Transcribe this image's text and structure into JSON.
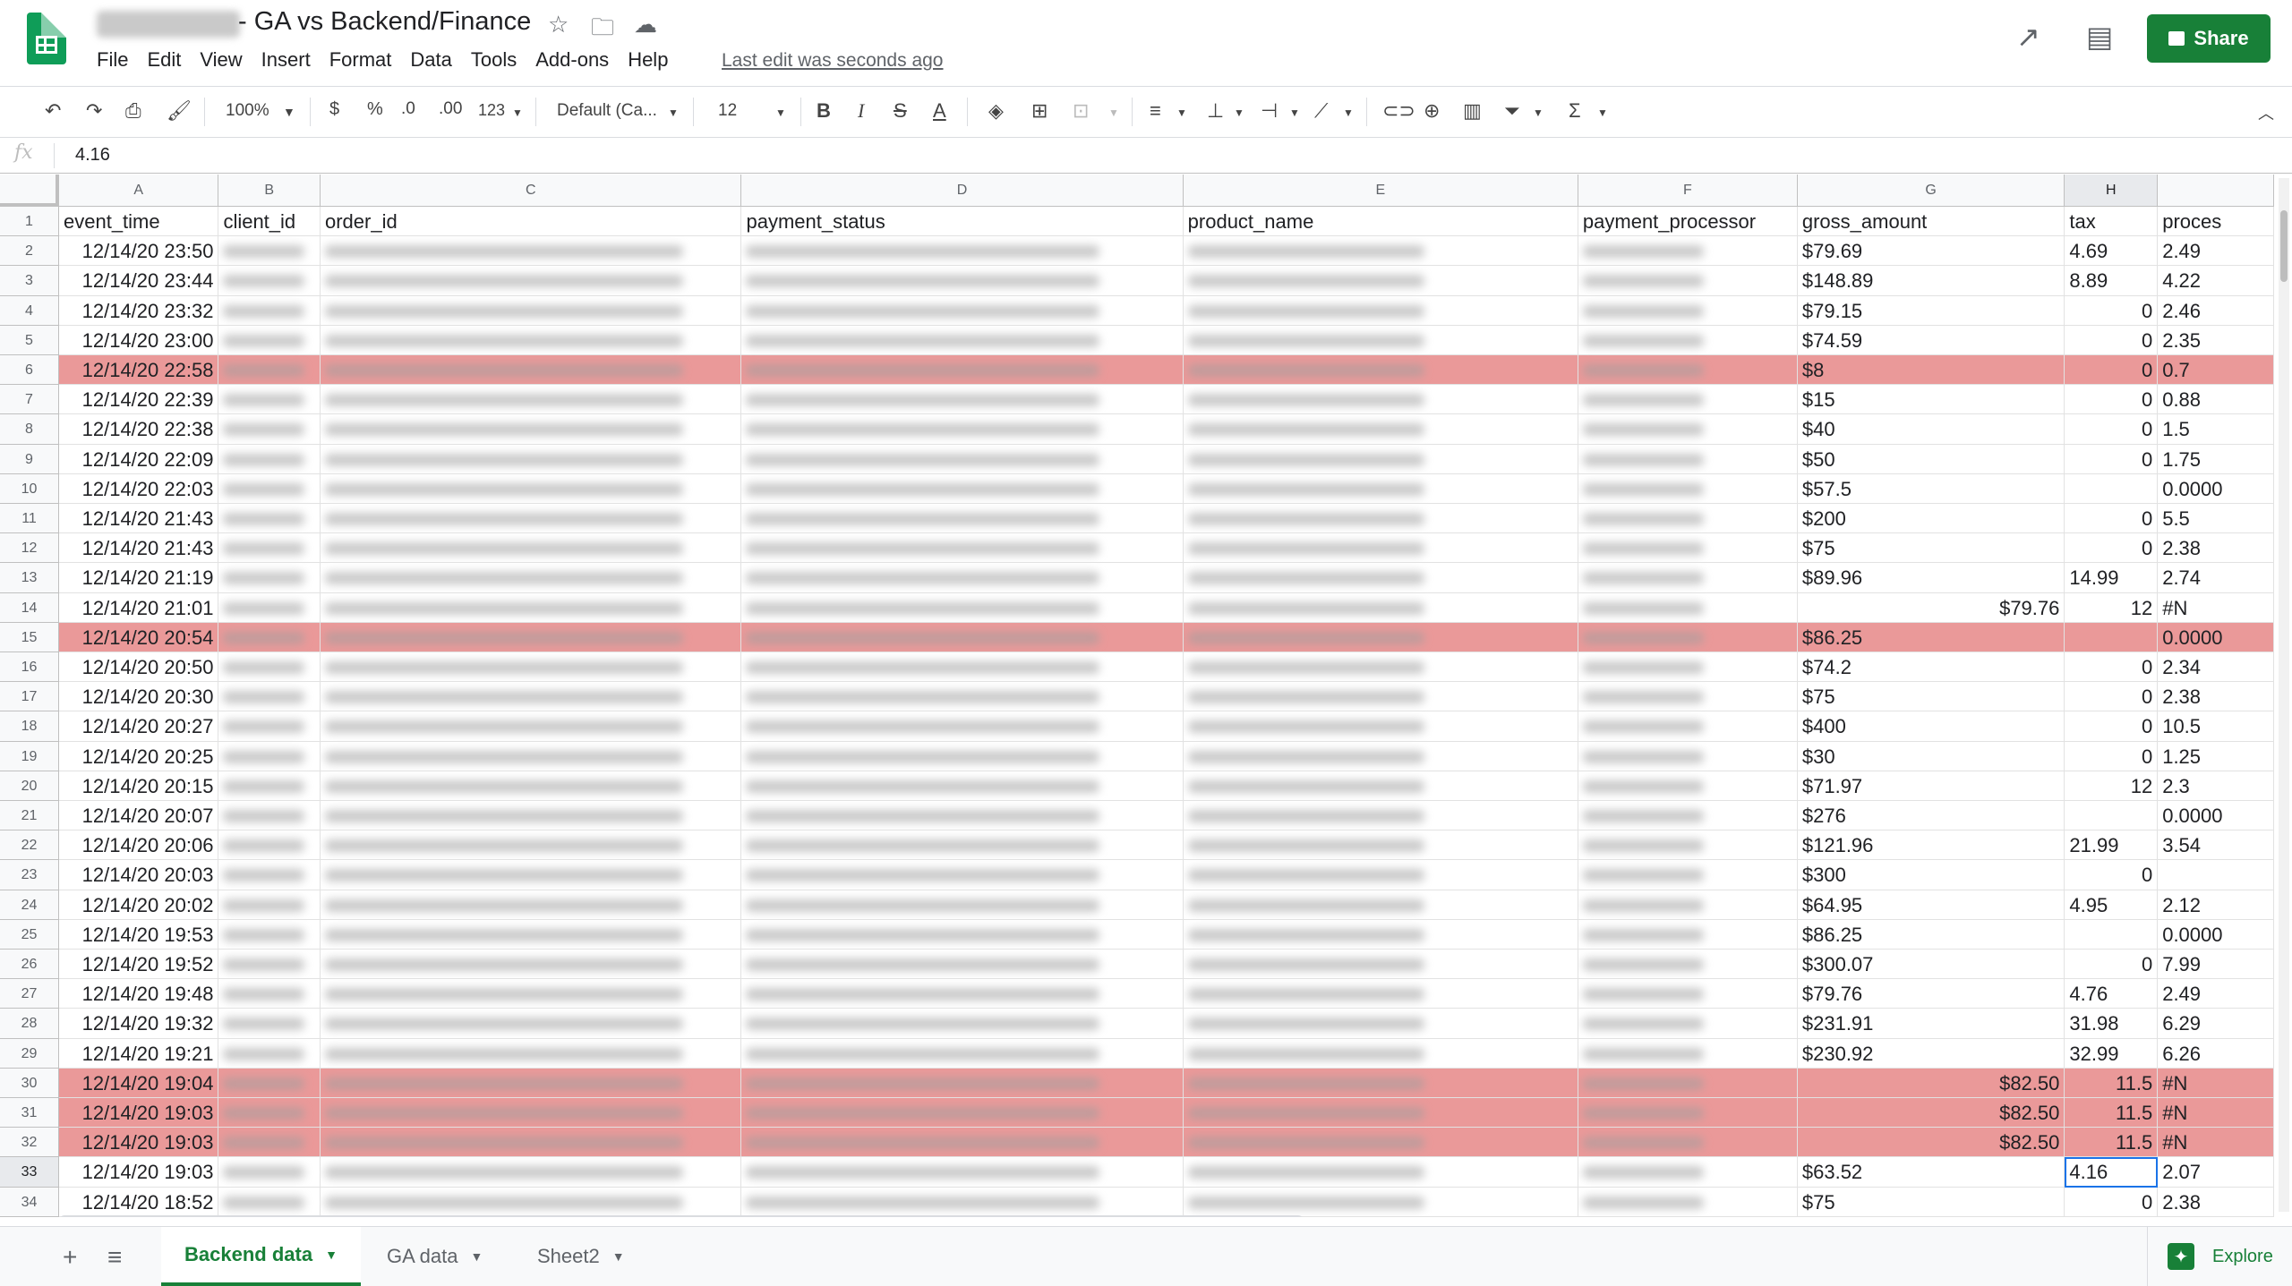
{
  "title": {
    "doc_title": "- GA vs Backend/Finance",
    "last_edit": "Last edit was seconds ago",
    "share_label": "Share"
  },
  "menu": [
    "File",
    "Edit",
    "View",
    "Insert",
    "Format",
    "Data",
    "Tools",
    "Add-ons",
    "Help"
  ],
  "toolbar": {
    "zoom": "100%",
    "currency": "$",
    "percent": "%",
    "dec_dec": ".0",
    "dec_inc": ".00",
    "more_formats": "123",
    "font": "Default (Ca...",
    "font_size": "12"
  },
  "formula_bar": {
    "fx": "fx",
    "value": "4.16"
  },
  "columns": [
    {
      "letter": "A",
      "w": 110
    },
    {
      "letter": "B",
      "w": 70
    },
    {
      "letter": "C",
      "w": 290
    },
    {
      "letter": "D",
      "w": 304
    },
    {
      "letter": "E",
      "w": 272
    },
    {
      "letter": "F",
      "w": 151
    },
    {
      "letter": "G",
      "w": 184
    },
    {
      "letter": "H",
      "w": 64
    },
    {
      "letter": "",
      "w": 80
    }
  ],
  "header_row": [
    "event_time",
    "client_id",
    "order_id",
    "payment_status",
    "product_name",
    "payment_processor",
    "gross_amount",
    "tax",
    "proces"
  ],
  "rows": [
    {
      "n": "2",
      "time": "12/14/20 23:50",
      "gross": "$79.69",
      "gross_align": "left",
      "tax": "4.69",
      "tax_align": "left",
      "proc": "2.49"
    },
    {
      "n": "3",
      "time": "12/14/20 23:44",
      "gross": "$148.89",
      "gross_align": "left",
      "tax": "8.89",
      "tax_align": "left",
      "proc": "4.22"
    },
    {
      "n": "4",
      "time": "12/14/20 23:32",
      "gross": "$79.15",
      "gross_align": "left",
      "tax": "0",
      "tax_align": "right",
      "proc": "2.46"
    },
    {
      "n": "5",
      "time": "12/14/20 23:00",
      "gross": "$74.59",
      "gross_align": "left",
      "tax": "0",
      "tax_align": "right",
      "proc": "2.35"
    },
    {
      "n": "6",
      "time": "12/14/20 22:58",
      "gross": "$8",
      "gross_align": "left",
      "tax": "0",
      "tax_align": "right",
      "proc": "0.7",
      "hl": true
    },
    {
      "n": "7",
      "time": "12/14/20 22:39",
      "gross": "$15",
      "gross_align": "left",
      "tax": "0",
      "tax_align": "right",
      "proc": "0.88"
    },
    {
      "n": "8",
      "time": "12/14/20 22:38",
      "gross": "$40",
      "gross_align": "left",
      "tax": "0",
      "tax_align": "right",
      "proc": "1.5"
    },
    {
      "n": "9",
      "time": "12/14/20 22:09",
      "gross": "$50",
      "gross_align": "left",
      "tax": "0",
      "tax_align": "right",
      "proc": "1.75"
    },
    {
      "n": "10",
      "time": "12/14/20 22:03",
      "gross": "$57.5",
      "gross_align": "left",
      "tax": "",
      "tax_align": "right",
      "proc": "0.0000"
    },
    {
      "n": "11",
      "time": "12/14/20 21:43",
      "gross": "$200",
      "gross_align": "left",
      "tax": "0",
      "tax_align": "right",
      "proc": "5.5"
    },
    {
      "n": "12",
      "time": "12/14/20 21:43",
      "gross": "$75",
      "gross_align": "left",
      "tax": "0",
      "tax_align": "right",
      "proc": "2.38"
    },
    {
      "n": "13",
      "time": "12/14/20 21:19",
      "gross": "$89.96",
      "gross_align": "left",
      "tax": "14.99",
      "tax_align": "left",
      "proc": "2.74"
    },
    {
      "n": "14",
      "time": "12/14/20 21:01",
      "gross": "$79.76",
      "gross_align": "right",
      "tax": "12",
      "tax_align": "right",
      "proc": "#N"
    },
    {
      "n": "15",
      "time": "12/14/20 20:54",
      "gross": "$86.25",
      "gross_align": "left",
      "tax": "",
      "tax_align": "right",
      "proc": "0.0000",
      "hl": true
    },
    {
      "n": "16",
      "time": "12/14/20 20:50",
      "gross": "$74.2",
      "gross_align": "left",
      "tax": "0",
      "tax_align": "right",
      "proc": "2.34"
    },
    {
      "n": "17",
      "time": "12/14/20 20:30",
      "gross": "$75",
      "gross_align": "left",
      "tax": "0",
      "tax_align": "right",
      "proc": "2.38"
    },
    {
      "n": "18",
      "time": "12/14/20 20:27",
      "gross": "$400",
      "gross_align": "left",
      "tax": "0",
      "tax_align": "right",
      "proc": "10.5"
    },
    {
      "n": "19",
      "time": "12/14/20 20:25",
      "gross": "$30",
      "gross_align": "left",
      "tax": "0",
      "tax_align": "right",
      "proc": "1.25"
    },
    {
      "n": "20",
      "time": "12/14/20 20:15",
      "gross": "$71.97",
      "gross_align": "left",
      "tax": "12",
      "tax_align": "right",
      "proc": "2.3"
    },
    {
      "n": "21",
      "time": "12/14/20 20:07",
      "gross": "$276",
      "gross_align": "left",
      "tax": "",
      "tax_align": "right",
      "proc": "0.0000"
    },
    {
      "n": "22",
      "time": "12/14/20 20:06",
      "gross": "$121.96",
      "gross_align": "left",
      "tax": "21.99",
      "tax_align": "left",
      "proc": "3.54"
    },
    {
      "n": "23",
      "time": "12/14/20 20:03",
      "gross": "$300",
      "gross_align": "left",
      "tax": "0",
      "tax_align": "right",
      "proc": ""
    },
    {
      "n": "24",
      "time": "12/14/20 20:02",
      "gross": "$64.95",
      "gross_align": "left",
      "tax": "4.95",
      "tax_align": "left",
      "proc": "2.12"
    },
    {
      "n": "25",
      "time": "12/14/20 19:53",
      "gross": "$86.25",
      "gross_align": "left",
      "tax": "",
      "tax_align": "right",
      "proc": "0.0000"
    },
    {
      "n": "26",
      "time": "12/14/20 19:52",
      "gross": "$300.07",
      "gross_align": "left",
      "tax": "0",
      "tax_align": "right",
      "proc": "7.99"
    },
    {
      "n": "27",
      "time": "12/14/20 19:48",
      "gross": "$79.76",
      "gross_align": "left",
      "tax": "4.76",
      "tax_align": "left",
      "proc": "2.49"
    },
    {
      "n": "28",
      "time": "12/14/20 19:32",
      "gross": "$231.91",
      "gross_align": "left",
      "tax": "31.98",
      "tax_align": "left",
      "proc": "6.29"
    },
    {
      "n": "29",
      "time": "12/14/20 19:21",
      "gross": "$230.92",
      "gross_align": "left",
      "tax": "32.99",
      "tax_align": "left",
      "proc": "6.26"
    },
    {
      "n": "30",
      "time": "12/14/20 19:04",
      "gross": "$82.50",
      "gross_align": "right",
      "tax": "11.5",
      "tax_align": "right",
      "proc": "#N",
      "hl": true
    },
    {
      "n": "31",
      "time": "12/14/20 19:03",
      "gross": "$82.50",
      "gross_align": "right",
      "tax": "11.5",
      "tax_align": "right",
      "proc": "#N",
      "hl": true
    },
    {
      "n": "32",
      "time": "12/14/20 19:03",
      "gross": "$82.50",
      "gross_align": "right",
      "tax": "11.5",
      "tax_align": "right",
      "proc": "#N",
      "hl": true
    },
    {
      "n": "33",
      "time": "12/14/20 19:03",
      "gross": "$63.52",
      "gross_align": "left",
      "tax": "4.16",
      "tax_align": "left",
      "proc": "2.07",
      "active": true
    },
    {
      "n": "34",
      "time": "12/14/20 18:52",
      "gross": "$75",
      "gross_align": "left",
      "tax": "0",
      "tax_align": "right",
      "proc": "2.38"
    }
  ],
  "sheets": [
    {
      "label": "Backend data",
      "active": true
    },
    {
      "label": "GA data"
    },
    {
      "label": "Sheet2"
    }
  ],
  "explore_label": "Explore",
  "colors": {
    "highlight": "#ea9999",
    "brand_green": "#188038",
    "active_border": "#1a73e8"
  }
}
